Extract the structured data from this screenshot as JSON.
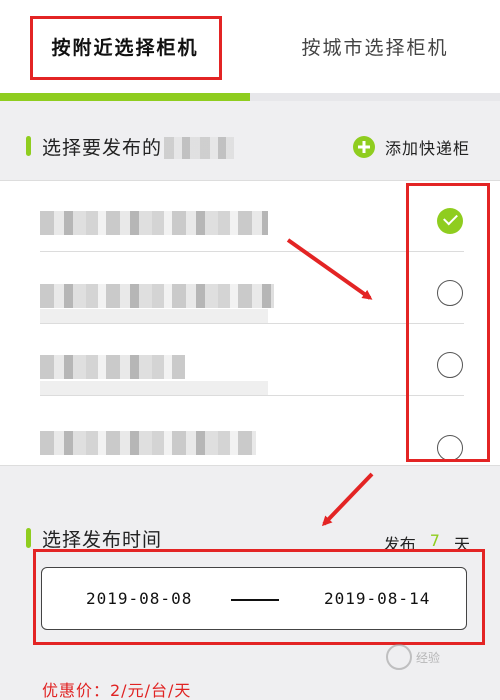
{
  "tabs": {
    "nearby_label": "按附近选择柜机",
    "city_label": "按城市选择柜机"
  },
  "section_lockers": {
    "title": "选择要发布的",
    "add_label": "添加快递柜"
  },
  "lockers": [
    {
      "selected": true
    },
    {
      "selected": false
    },
    {
      "selected": false
    },
    {
      "selected": false
    }
  ],
  "section_time": {
    "title": "选择发布时间",
    "publish_prefix": "发布",
    "publish_days": "7",
    "publish_unit": "天"
  },
  "date_range": {
    "start": "2019-08-08",
    "end": "2019-08-14"
  },
  "price_text": "优惠价：2/元/台/天",
  "colors": {
    "accent": "#8fcd1f",
    "annotation": "#e32424",
    "price": "#e02323"
  },
  "watermark": {
    "text": "经验"
  }
}
